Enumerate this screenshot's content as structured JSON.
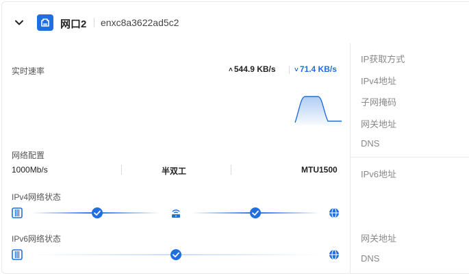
{
  "header": {
    "port_name": "网口2",
    "mac": "enxc8a3622ad5c2"
  },
  "speed": {
    "label": "实时速率",
    "upload": "544.9 KB/s",
    "download": "71.4 KB/s"
  },
  "network_config": {
    "label": "网络配置",
    "link_speed": "1000Mb/s",
    "duplex": "半双工",
    "mtu": "MTU1500"
  },
  "ipv4_status": {
    "label": "IPv4网络状态"
  },
  "ipv6_status": {
    "label": "IPv6网络状态"
  },
  "right_panel": {
    "ip_mode_label": "IP获取方式",
    "ipv4_label": "IPv4地址",
    "subnet_label": "子网掩码",
    "gateway_label": "网关地址",
    "dns_label": "DNS",
    "ipv6_label": "IPv6地址",
    "ipv6_gateway_label": "网关地址",
    "ipv6_dns_label": "DNS"
  },
  "icons": {
    "collapse": "chevron-down-icon",
    "port": "ethernet-port-icon",
    "device": "device-icon",
    "router": "router-icon",
    "check": "check-circle-icon",
    "internet": "globe-icon"
  },
  "colors": {
    "accent": "#1f6fe0",
    "track": "#c9dcf7",
    "text_muted": "#888888"
  }
}
